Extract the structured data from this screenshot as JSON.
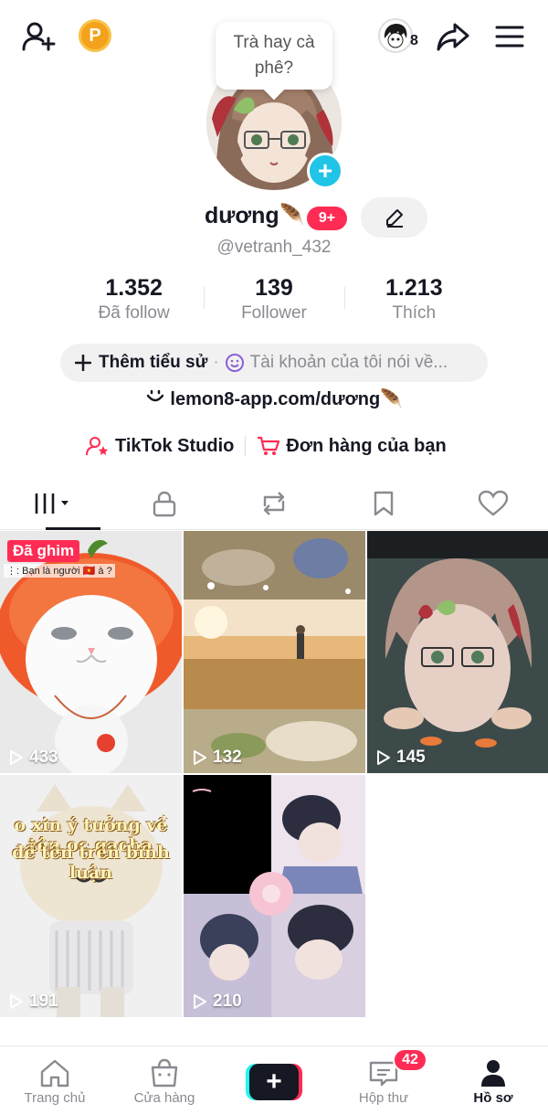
{
  "header": {
    "speech_bubble": "Trà hay cà phê?",
    "coin_label": "P",
    "story_count": "8"
  },
  "profile": {
    "display_name": "dương",
    "name_decoration": "🪶",
    "notification_badge": "9+",
    "username": "@vetranh_432"
  },
  "stats": [
    {
      "value": "1.352",
      "label": "Đã follow"
    },
    {
      "value": "139",
      "label": "Follower"
    },
    {
      "value": "1.213",
      "label": "Thích"
    }
  ],
  "bio": {
    "add_label": "Thêm tiểu sử",
    "separator": "·",
    "hint": "Tài khoản của tôi nói về..."
  },
  "link": {
    "text": "lemon8-app.com/dương",
    "decoration": "🪶"
  },
  "actions": {
    "studio": "TikTok Studio",
    "orders": "Đơn hàng của bạn"
  },
  "tabs": [
    "videos",
    "private",
    "reposts",
    "favorites",
    "liked"
  ],
  "videos": [
    {
      "views": "433",
      "pinned_label": "Đã ghim",
      "caption": "⋮: Bạn là người 🇻🇳 à ?"
    },
    {
      "views": "132"
    },
    {
      "views": "145"
    },
    {
      "views": "191",
      "overlay_line1": "o xin ý tưởng về tên oc gacha",
      "overlay_line2": "để tên trên bình luận"
    },
    {
      "views": "210"
    }
  ],
  "bottom_nav": {
    "home": "Trang chủ",
    "shop": "Cửa hàng",
    "inbox": "Hộp thư",
    "inbox_badge": "42",
    "profile": "Hồ sơ"
  },
  "colors": {
    "accent": "#fe2c55",
    "cyan": "#25f4ee",
    "text": "#161823",
    "muted": "#8a8b91"
  }
}
